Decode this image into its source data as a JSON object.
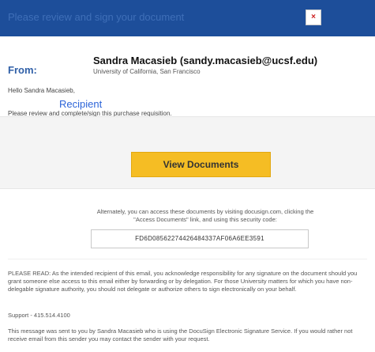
{
  "header": {
    "title": "Please review and sign your document",
    "icon": "broken-image-icon",
    "icon_glyph": "×"
  },
  "from": {
    "label": "From:",
    "sender_name": "Sandra Macasieb (sandy.macasieb@ucsf.edu)",
    "sender_org": "University of California, San Francisco"
  },
  "message": {
    "greeting": "Hello Sandra Macasieb,",
    "recipient_label": "Recipient",
    "instruction": "Please review and complete/sign this purchase requisition."
  },
  "action": {
    "view_button_label": "View Documents"
  },
  "access": {
    "alt_text": "Alternately, you can access these documents by visiting docusign.com, clicking the \"Access Documents\" link, and using this security code:",
    "security_code": "FD6D08562274426484337AF06A6EE3591"
  },
  "legal": {
    "please_read": "PLEASE READ: As the intended recipient of this email, you acknowledge responsibility for any signature on the document should you grant someone else access to this email either by forwarding or by delegation. For those University matters for which you have non-delegable signature authority, you should not delegate or authorize others to sign electronically on your behalf.",
    "support": "Support - 415.514.4100",
    "footer": "This message was sent to you by Sandra Macasieb who is using the DocuSign Electronic Signature Service. If you would rather not receive email from this sender you may contact the sender with your request."
  },
  "colors": {
    "header_bg": "#1d4e9a",
    "from_label": "#2f5fa7",
    "recipient_label": "#2c64d8",
    "button_bg": "#f5bd24",
    "band_bg": "#f4f4f4"
  }
}
